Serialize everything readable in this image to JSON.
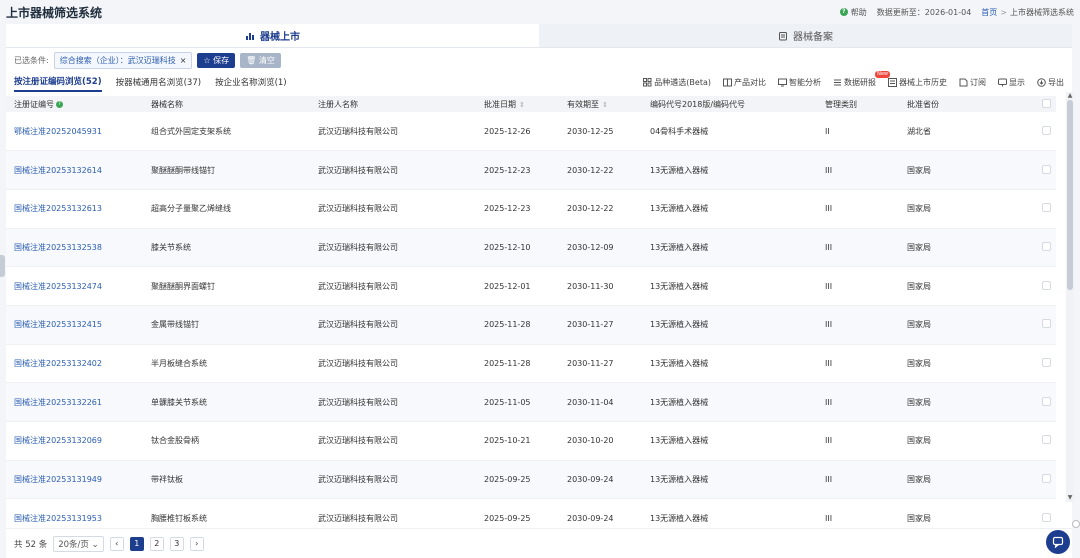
{
  "header": {
    "title": "上市器械筛选系统",
    "help": "帮助",
    "update_label": "数据更新至：2026-01-04",
    "breadcrumb_home": "首页",
    "breadcrumb_current": "上市器械筛选系统"
  },
  "main_tabs": [
    {
      "label": "器械上市",
      "icon": "bar-chart-icon",
      "active": true
    },
    {
      "label": "器械备案",
      "icon": "clipboard-icon",
      "active": false
    }
  ],
  "filter": {
    "label": "已选条件:",
    "chip": "综合搜索（企业）：武汉迈瑞科技",
    "save": "保存",
    "clear": "清空"
  },
  "subtabs": [
    {
      "label": "按注册证编码浏览(52)",
      "active": true
    },
    {
      "label": "按器械通用名浏览(37)",
      "active": false
    },
    {
      "label": "按企业名称浏览(1)",
      "active": false
    }
  ],
  "tools": [
    {
      "label": "品种遴选(Beta)",
      "icon": "grid-icon"
    },
    {
      "label": "产品对比",
      "icon": "compare-icon"
    },
    {
      "label": "智能分析",
      "icon": "monitor-icon"
    },
    {
      "label": "数据研报",
      "icon": "report-icon",
      "badge": "New"
    },
    {
      "label": "器械上市历史",
      "icon": "history-icon"
    },
    {
      "label": "订阅",
      "icon": "subscribe-icon"
    },
    {
      "label": "显示",
      "icon": "display-icon"
    },
    {
      "label": "导出",
      "icon": "export-icon"
    }
  ],
  "table": {
    "columns": [
      "注册证编号",
      "器械名称",
      "注册人名称",
      "批准日期",
      "有效期至",
      "编码代号2018版/编码代号",
      "管理类别",
      "批准省份"
    ],
    "rows": [
      [
        "鄂械注准20252045931",
        "组合式外固定支架系统",
        "武汉迈瑞科技有限公司",
        "2025-12-26",
        "2030-12-25",
        "04骨科手术器械",
        "II",
        "湖北省"
      ],
      [
        "国械注准20253132614",
        "聚醚醚酮带线锚钉",
        "武汉迈瑞科技有限公司",
        "2025-12-23",
        "2030-12-22",
        "13无源植入器械",
        "III",
        "国家局"
      ],
      [
        "国械注准20253132613",
        "超高分子量聚乙烯缝线",
        "武汉迈瑞科技有限公司",
        "2025-12-23",
        "2030-12-22",
        "13无源植入器械",
        "III",
        "国家局"
      ],
      [
        "国械注准20253132538",
        "膝关节系统",
        "武汉迈瑞科技有限公司",
        "2025-12-10",
        "2030-12-09",
        "13无源植入器械",
        "III",
        "国家局"
      ],
      [
        "国械注准20253132474",
        "聚醚醚酮界面螺钉",
        "武汉迈瑞科技有限公司",
        "2025-12-01",
        "2030-11-30",
        "13无源植入器械",
        "III",
        "国家局"
      ],
      [
        "国械注准20253132415",
        "金属带线锚钉",
        "武汉迈瑞科技有限公司",
        "2025-11-28",
        "2030-11-27",
        "13无源植入器械",
        "III",
        "国家局"
      ],
      [
        "国械注准20253132402",
        "半月板缝合系统",
        "武汉迈瑞科技有限公司",
        "2025-11-28",
        "2030-11-27",
        "13无源植入器械",
        "III",
        "国家局"
      ],
      [
        "国械注准20253132261",
        "单髁膝关节系统",
        "武汉迈瑞科技有限公司",
        "2025-11-05",
        "2030-11-04",
        "13无源植入器械",
        "III",
        "国家局"
      ],
      [
        "国械注准20253132069",
        "钛合金股骨柄",
        "武汉迈瑞科技有限公司",
        "2025-10-21",
        "2030-10-20",
        "13无源植入器械",
        "III",
        "国家局"
      ],
      [
        "国械注准20253131949",
        "带袢钛板",
        "武汉迈瑞科技有限公司",
        "2025-09-25",
        "2030-09-24",
        "13无源植入器械",
        "III",
        "国家局"
      ],
      [
        "国械注准20253131953",
        "胸腰椎钉板系统",
        "武汉迈瑞科技有限公司",
        "2025-09-25",
        "2030-09-24",
        "13无源植入器械",
        "III",
        "国家局"
      ]
    ]
  },
  "pager": {
    "total": "共 52 条",
    "page_size": "20条/页",
    "pages": [
      "1",
      "2",
      "3"
    ],
    "current": "1"
  },
  "colors": {
    "primary": "#1d3d8f",
    "link": "#2a5db0",
    "help": "#3aa655",
    "new_badge": "#f0473c"
  }
}
